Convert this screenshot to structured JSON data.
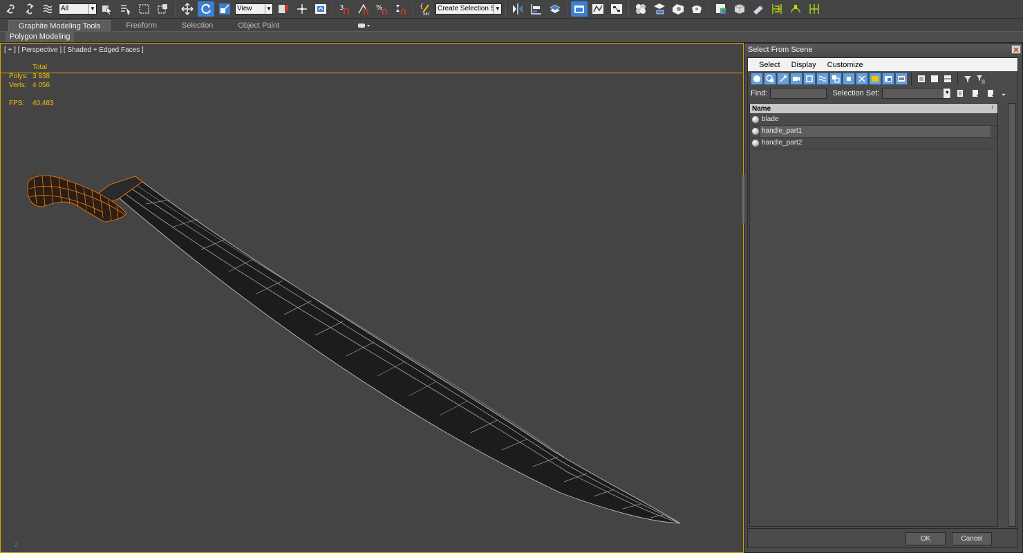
{
  "toolbar": {
    "filter_dropdown": "All",
    "ref_coord_dropdown": "View",
    "selection_set_dropdown": "Create Selection Se",
    "snap_label": "3"
  },
  "ribbon": {
    "tabs": [
      "Graphite Modeling Tools",
      "Freeform",
      "Selection",
      "Object Paint"
    ],
    "active_tab": 0,
    "panel_label": "Polygon Modeling"
  },
  "viewport": {
    "label": "[ + ] [ Perspective ] [ Shaded + Edged Faces ]",
    "stats": {
      "total_label": "Total",
      "polys_label": "Polys:",
      "polys_value": "3 938",
      "verts_label": "Verts:",
      "verts_value": "4 056",
      "fps_label": "FPS:",
      "fps_value": "40,483"
    },
    "axis_label": "z",
    "border_color": "#d9a400",
    "stats_color": "#f2c200",
    "selection_color": "#ff7a00"
  },
  "dialog": {
    "title": "Select From Scene",
    "menu": [
      "Select",
      "Display",
      "Customize"
    ],
    "find_label": "Find:",
    "find_value": "",
    "selection_set_label": "Selection Set:",
    "column_name": "Name",
    "rows": [
      {
        "name": "blade",
        "selected": false
      },
      {
        "name": "handle_part1",
        "selected": true
      },
      {
        "name": "handle_part2",
        "selected": false
      }
    ],
    "ok_label": "OK",
    "cancel_label": "Cancel"
  }
}
